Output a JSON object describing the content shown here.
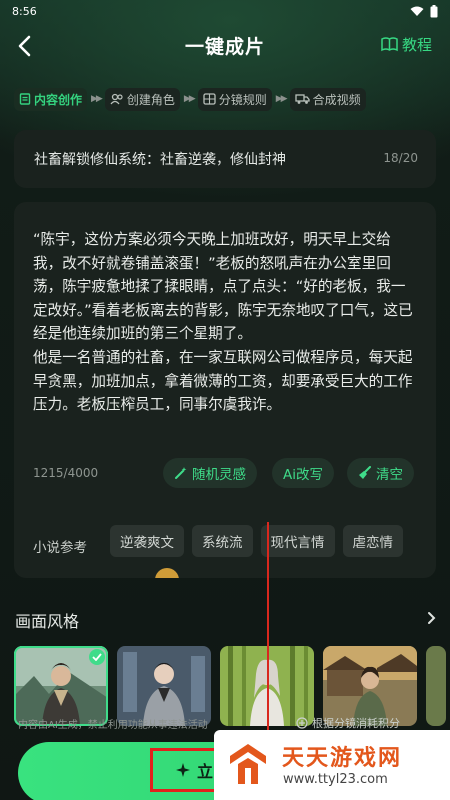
{
  "status_bar": {
    "time": "8:56"
  },
  "header": {
    "title": "一键成片",
    "tutorial_label": "教程"
  },
  "steps": [
    {
      "label": "内容创作",
      "active": true
    },
    {
      "label": "创建角色",
      "active": false
    },
    {
      "label": "分镜规则",
      "active": false
    },
    {
      "label": "合成视频",
      "active": false
    }
  ],
  "title_field": {
    "value": "社畜解锁修仙系统：社畜逆袭，修仙封神",
    "count": "18/20"
  },
  "content_field": {
    "value": "“陈宇，这份方案必须今天晚上加班改好，明天早上交给我，改不好就卷铺盖滚蛋！”老板的怒吼声在办公室里回荡，陈宇疲惫地揉了揉眼睛，点了点头：“好的老板，我一定改好。”看着老板离去的背影，陈宇无奈地叹了口气，这已经是他连续加班的第三个星期了。\n他是一名普通的社畜，在一家互联网公司做程序员，每天起早贪黑，加班加点，拿着微薄的工资，却要承受巨大的工作压力。老板压榨员工，同事尔虞我诈。",
    "count": "1215/4000"
  },
  "actions": {
    "random": "随机灵感",
    "ai_rewrite": "Ai改写",
    "clear": "清空"
  },
  "reference": {
    "label": "小说参考",
    "tags": [
      "逆袭爽文",
      "系统流",
      "现代言情",
      "虐恋情"
    ]
  },
  "style": {
    "title": "画面风格"
  },
  "footer": {
    "disclaimer": "内容由AI生成，禁止利用功能从事违法活动",
    "right_note": "根据分镜消耗积分",
    "cta_label": "立"
  },
  "watermark": {
    "name": "天天游戏网",
    "url": "www.ttyl23.com"
  }
}
